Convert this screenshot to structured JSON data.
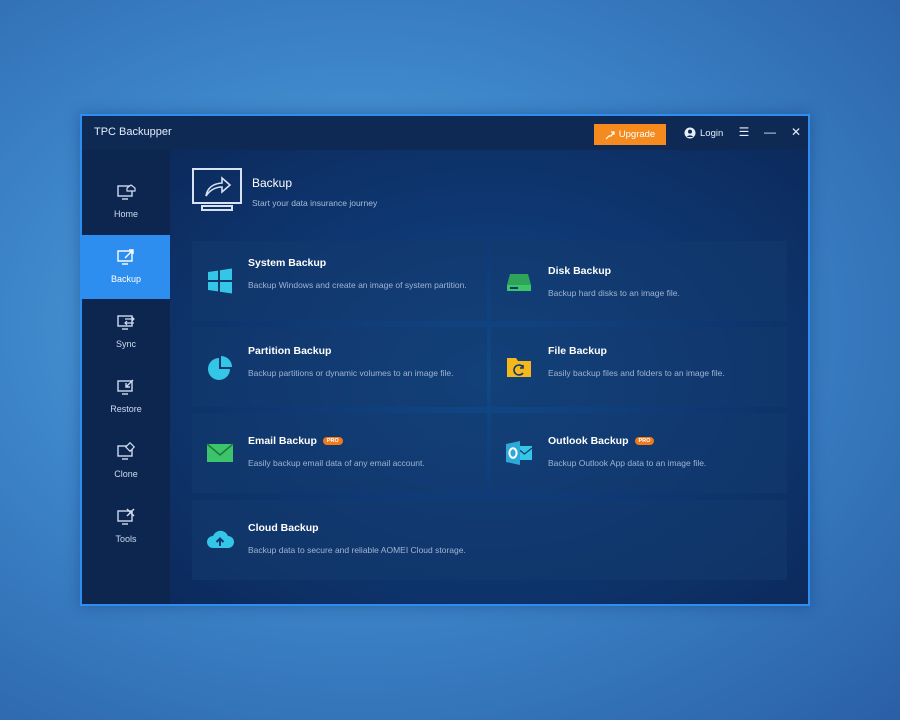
{
  "app": {
    "title": "TPC Backupper"
  },
  "titlebar": {
    "upgrade_label": "Upgrade",
    "login_label": "Login"
  },
  "sidebar": {
    "items": [
      {
        "label": "Home",
        "icon": "home-icon"
      },
      {
        "label": "Backup",
        "icon": "backup-icon",
        "active": true
      },
      {
        "label": "Sync",
        "icon": "sync-icon"
      },
      {
        "label": "Restore",
        "icon": "restore-icon"
      },
      {
        "label": "Clone",
        "icon": "clone-icon"
      },
      {
        "label": "Tools",
        "icon": "tools-icon"
      }
    ]
  },
  "header": {
    "title": "Backup",
    "subtitle": "Start your data insurance journey"
  },
  "cards": [
    {
      "title": "System Backup",
      "desc": "Backup Windows and create an image of system partition.",
      "icon": "windows-icon"
    },
    {
      "title": "Disk Backup",
      "desc": "Backup hard disks to an image file.",
      "icon": "disk-icon"
    },
    {
      "title": "Partition Backup",
      "desc": "Backup partitions or dynamic volumes to an image file.",
      "icon": "pie-chart-icon"
    },
    {
      "title": "File Backup",
      "desc": "Easily backup files and folders to an image file.",
      "icon": "folder-icon"
    },
    {
      "title": "Email Backup",
      "desc": "Easily backup email data of any email account.",
      "icon": "envelope-icon",
      "badge": "PRO"
    },
    {
      "title": "Outlook Backup",
      "desc": "Backup Outlook App data to an image file.",
      "icon": "outlook-icon",
      "badge": "PRO"
    },
    {
      "title": "Cloud Backup",
      "desc": "Backup data to secure and reliable AOMEI Cloud storage.",
      "icon": "cloud-upload-icon"
    }
  ],
  "colors": {
    "accent": "#2d8ef0",
    "upgrade": "#f58a1f",
    "window_bg": "#0f2d5a",
    "icon_teal": "#34c6e6",
    "icon_green": "#3cc46a"
  }
}
